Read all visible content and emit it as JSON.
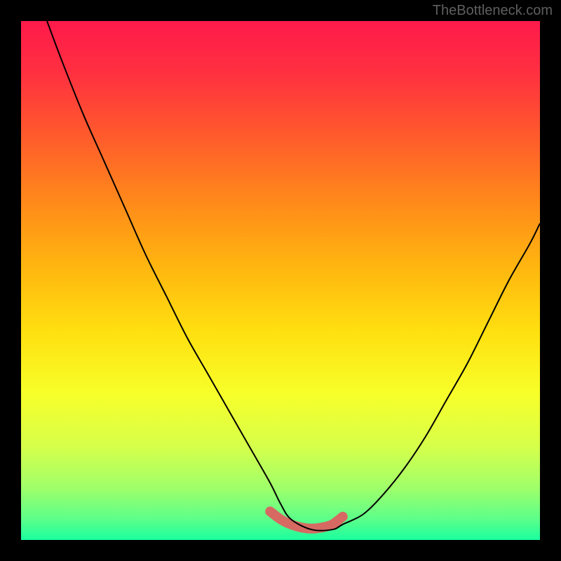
{
  "watermark": "TheBottleneck.com",
  "gradient": {
    "stops": [
      {
        "offset": 0.0,
        "color": "#ff1a4b"
      },
      {
        "offset": 0.1,
        "color": "#ff3040"
      },
      {
        "offset": 0.22,
        "color": "#ff5a2c"
      },
      {
        "offset": 0.35,
        "color": "#ff8a1a"
      },
      {
        "offset": 0.48,
        "color": "#ffb80f"
      },
      {
        "offset": 0.6,
        "color": "#ffe010"
      },
      {
        "offset": 0.72,
        "color": "#f7ff2a"
      },
      {
        "offset": 0.82,
        "color": "#d6ff4a"
      },
      {
        "offset": 0.9,
        "color": "#9fff6a"
      },
      {
        "offset": 0.96,
        "color": "#5cff8a"
      },
      {
        "offset": 1.0,
        "color": "#1aff9e"
      }
    ]
  },
  "chart_data": {
    "type": "line",
    "title": "",
    "xlabel": "",
    "ylabel": "",
    "xlim": [
      0,
      100
    ],
    "ylim": [
      0,
      100
    ],
    "series": [
      {
        "name": "curve",
        "x": [
          5,
          8,
          12,
          16,
          20,
          24,
          28,
          32,
          36,
          40,
          44,
          48,
          50,
          52,
          56,
          60,
          62,
          66,
          70,
          74,
          78,
          82,
          86,
          90,
          94,
          98,
          100
        ],
        "y": [
          100,
          92,
          82,
          73,
          64,
          55,
          47,
          39,
          32,
          25,
          18,
          11,
          7,
          4,
          2,
          2,
          3,
          5,
          9,
          14,
          20,
          27,
          34,
          42,
          50,
          57,
          61
        ]
      },
      {
        "name": "highlight",
        "x": [
          48,
          50,
          52,
          54,
          56,
          58,
          60,
          62
        ],
        "y": [
          5.5,
          4,
          3,
          2.4,
          2.2,
          2.4,
          3,
          4.5
        ]
      }
    ],
    "styles": {
      "curve": {
        "stroke": "#000000",
        "width": 2
      },
      "highlight": {
        "stroke": "#d66a63",
        "width": 14,
        "linecap": "round"
      }
    }
  }
}
